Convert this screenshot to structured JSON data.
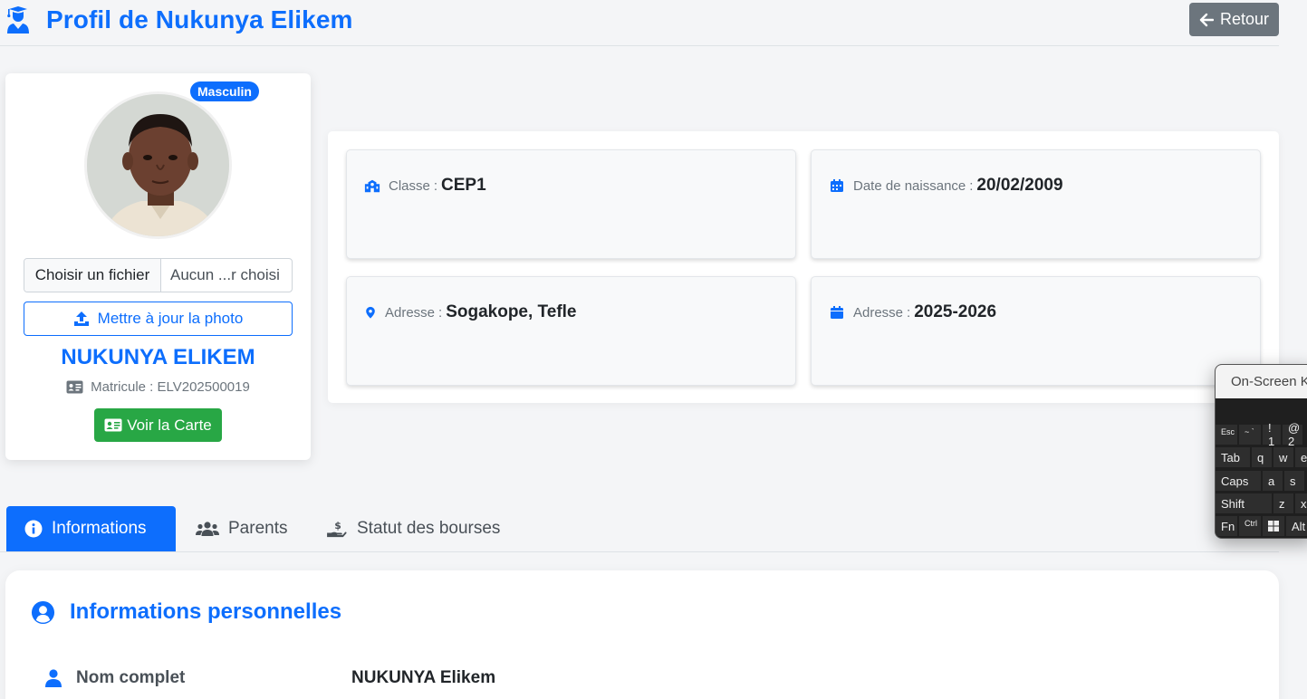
{
  "header": {
    "title": "Profil de Nukunya Elikem",
    "back_label": "Retour"
  },
  "profile": {
    "gender_badge": "Masculin",
    "file_button_label": "Choisir un fichier",
    "file_status": "Aucun ...r choisi",
    "upload_label": "Mettre à jour la photo",
    "name": "NUKUNYA ELIKEM",
    "matricule_label": "Matricule : ELV202500019",
    "card_button_label": "Voir la Carte"
  },
  "info": {
    "classe": {
      "label": "Classe",
      "value": "CEP1"
    },
    "naissance": {
      "label": "Date de naissance",
      "value": "20/02/2009"
    },
    "adresse": {
      "label": "Adresse",
      "value": "Sogakope, Tefle"
    },
    "annee": {
      "label": "Adresse",
      "value": "2025-2026"
    }
  },
  "tabs": [
    {
      "label": "Informations",
      "icon": "info-circle-icon",
      "active": true
    },
    {
      "label": "Parents",
      "icon": "users-icon",
      "active": false
    },
    {
      "label": "Statut des bourses",
      "icon": "hand-holding-dollar-icon",
      "active": false
    }
  ],
  "personal": {
    "title": "Informations personnelles",
    "fields": [
      {
        "label": "Nom complet",
        "value": "NUKUNYA Elikem"
      }
    ]
  },
  "osk": {
    "title": "On-Screen Keyboard",
    "rows": [
      [
        "Esc",
        "~ `",
        "! 1",
        "@ 2"
      ],
      [
        "Tab",
        "q",
        "w",
        "e"
      ],
      [
        "Caps",
        "a",
        "s"
      ],
      [
        "Shift",
        "z",
        "x"
      ],
      [
        "Fn",
        "Ctrl",
        "win",
        "Alt"
      ]
    ]
  },
  "colors": {
    "primary": "#0d6efd",
    "success": "#28a745",
    "secondary": "#6c757d"
  }
}
